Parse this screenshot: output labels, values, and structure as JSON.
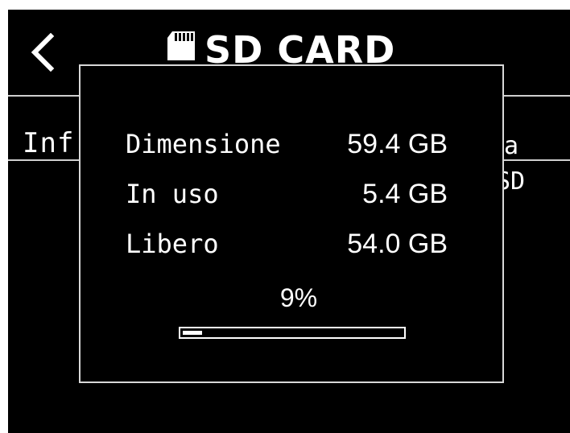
{
  "header": {
    "back_icon": "chevron-left-icon",
    "sd_icon": "sd-card-icon",
    "title": "SD CARD"
  },
  "background": {
    "row_left_partial": "Inf",
    "row_right_partial": "ta",
    "row_right_partial2": "SD"
  },
  "popup": {
    "rows": [
      {
        "label": "Dimensione",
        "value": "59.4 GB"
      },
      {
        "label": "In uso",
        "value": "5.4 GB"
      },
      {
        "label": "Libero",
        "value": "54.0 GB"
      }
    ],
    "percent_label": "9%",
    "progress_fraction": 0.09
  },
  "colors": {
    "background": "#000000",
    "foreground": "#ffffff",
    "divider": "#cfcfcf"
  }
}
